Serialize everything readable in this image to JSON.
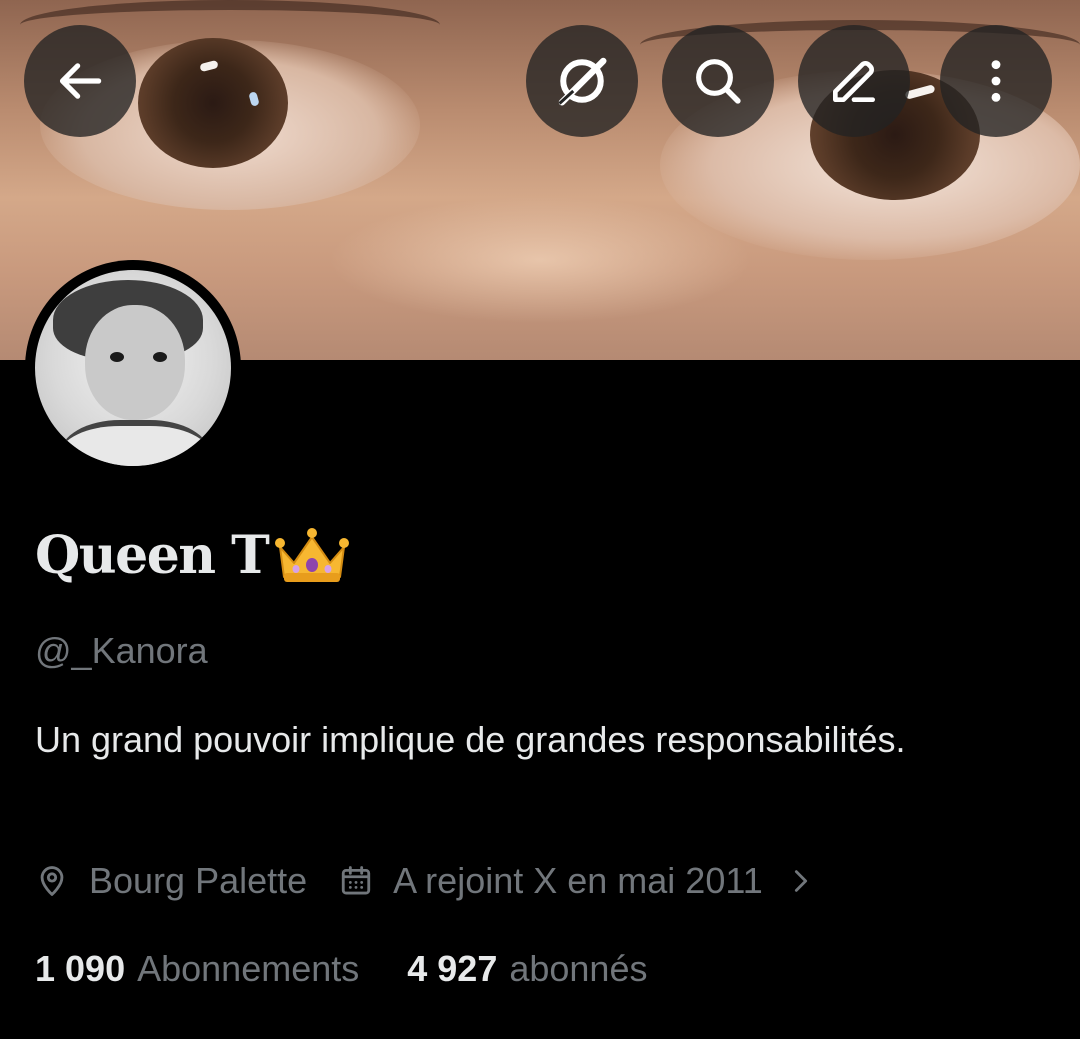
{
  "header": {
    "buttons": [
      {
        "name": "back-button",
        "icon": "arrow-left-icon"
      },
      {
        "name": "grok-button",
        "icon": "grok-icon"
      },
      {
        "name": "search-button",
        "icon": "search-icon"
      },
      {
        "name": "edit-button",
        "icon": "pencil-icon"
      },
      {
        "name": "more-button",
        "icon": "more-vertical-icon"
      }
    ]
  },
  "profile": {
    "display_name": "Queen T",
    "name_emoji": "crown-emoji",
    "handle": "@_Kanora",
    "bio": "Un grand pouvoir implique de grandes responsabilités.",
    "location": "Bourg Palette",
    "location_icon": "location-pin-icon",
    "joined": "A rejoint X en mai 2011",
    "joined_icon": "calendar-icon",
    "joined_chevron_icon": "chevron-right-icon",
    "following_count": "1 090",
    "following_label": "Abonnements",
    "followers_count": "4 927",
    "followers_label": "abonnés"
  },
  "colors": {
    "background": "#000000",
    "primary_text": "#e7e9ea",
    "secondary_text": "#71767b",
    "button_bg": "#232323"
  }
}
